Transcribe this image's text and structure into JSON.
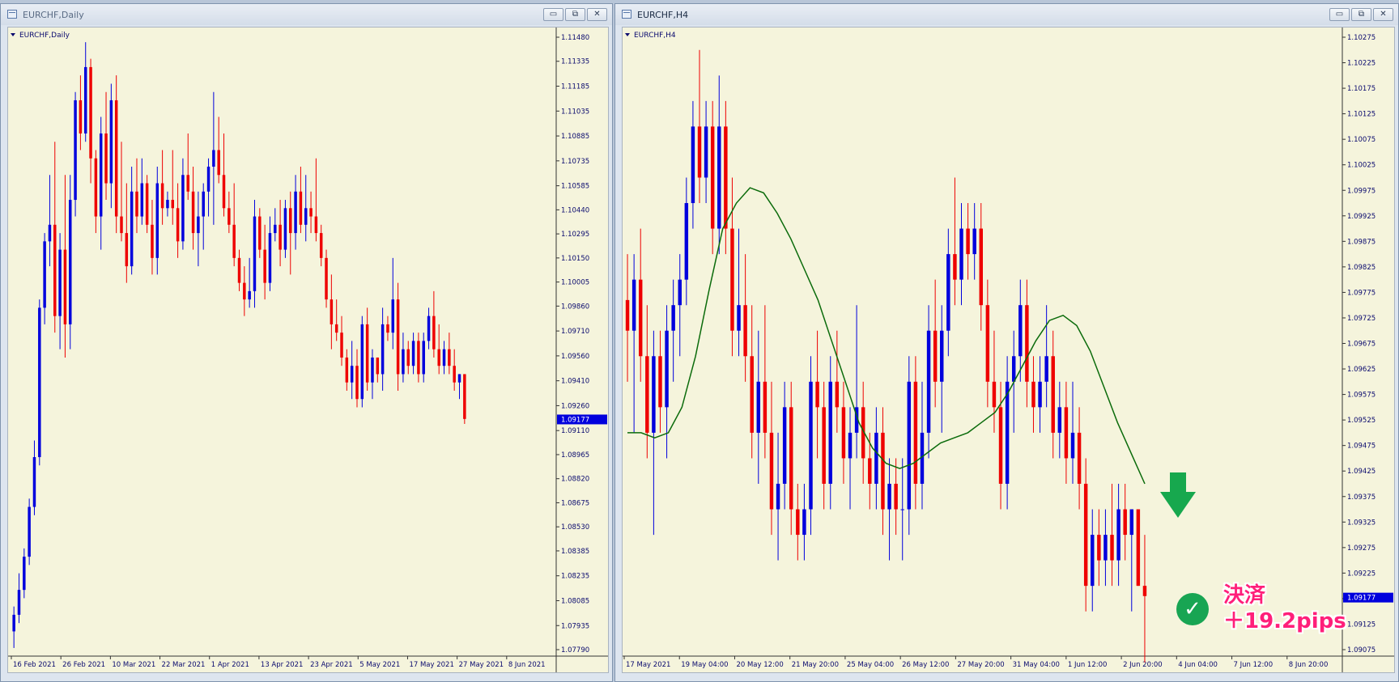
{
  "windows": [
    {
      "title": "EURCHF,Daily",
      "symbol_label": "EURCHF,Daily"
    },
    {
      "title": "EURCHF,H4",
      "symbol_label": "EURCHF,H4"
    }
  ],
  "buttons": {
    "minimize": "▭",
    "restore": "⧉",
    "close": "✕"
  },
  "colors": {
    "bull": "#0000dd",
    "bear": "#ee0000",
    "ma": "#0b6b0b",
    "background": "#f5f4dc",
    "axis_text": "#0a0a6e",
    "price_tag": "#0000dd",
    "callout": "#ff1f7a",
    "check": "#18a553",
    "arrow": "#17a84e"
  },
  "annotation": {
    "line1": "決済",
    "line2": "＋19.2pips",
    "check_icon": "check-circle-icon",
    "arrow_icon": "down-arrow-icon"
  },
  "chart_data": [
    {
      "type": "candlestick",
      "title": "EURCHF,Daily",
      "price_ticks": [
        "1.11480",
        "1.11335",
        "1.11185",
        "1.11035",
        "1.10885",
        "1.10735",
        "1.10585",
        "1.10440",
        "1.10295",
        "1.10150",
        "1.10005",
        "1.09860",
        "1.09710",
        "1.09560",
        "1.09410",
        "1.09260",
        "1.09110",
        "1.08965",
        "1.08820",
        "1.08675",
        "1.08530",
        "1.08385",
        "1.08235",
        "1.08085",
        "1.07935",
        "1.07790"
      ],
      "ylim": [
        1.0779,
        1.1148
      ],
      "current_price": "1.09177",
      "date_ticks": [
        "16 Feb 2021",
        "26 Feb 2021",
        "10 Mar 2021",
        "22 Mar 2021",
        "1 Apr 2021",
        "13 Apr 2021",
        "23 Apr 2021",
        "5 May 2021",
        "17 May 2021",
        "27 May 2021",
        "8 Jun 2021"
      ],
      "ohlc": [
        [
          1.079,
          1.0805,
          1.078,
          1.08
        ],
        [
          1.08,
          1.0825,
          1.0795,
          1.0815
        ],
        [
          1.0815,
          1.084,
          1.081,
          1.0835
        ],
        [
          1.0835,
          1.087,
          1.083,
          1.0865
        ],
        [
          1.0865,
          1.0905,
          1.086,
          1.0895
        ],
        [
          1.0895,
          1.099,
          1.089,
          1.0985
        ],
        [
          1.0985,
          1.103,
          1.0975,
          1.1025
        ],
        [
          1.1025,
          1.1065,
          1.101,
          1.1035
        ],
        [
          1.1035,
          1.1085,
          1.097,
          1.098
        ],
        [
          1.098,
          1.103,
          1.096,
          1.102
        ],
        [
          1.102,
          1.1065,
          1.0955,
          1.0975
        ],
        [
          1.0975,
          1.1065,
          1.096,
          1.105
        ],
        [
          1.105,
          1.1115,
          1.104,
          1.111
        ],
        [
          1.111,
          1.1125,
          1.108,
          1.109
        ],
        [
          1.109,
          1.1145,
          1.1085,
          1.113
        ],
        [
          1.113,
          1.1135,
          1.106,
          1.1075
        ],
        [
          1.1075,
          1.108,
          1.103,
          1.104
        ],
        [
          1.104,
          1.11,
          1.102,
          1.109
        ],
        [
          1.109,
          1.1115,
          1.105,
          1.106
        ],
        [
          1.106,
          1.112,
          1.1045,
          1.111
        ],
        [
          1.111,
          1.1125,
          1.103,
          1.104
        ],
        [
          1.104,
          1.1085,
          1.1025,
          1.103
        ],
        [
          1.103,
          1.106,
          1.1,
          1.101
        ],
        [
          1.101,
          1.107,
          1.1005,
          1.1055
        ],
        [
          1.1055,
          1.1075,
          1.103,
          1.104
        ],
        [
          1.104,
          1.1075,
          1.1035,
          1.106
        ],
        [
          1.106,
          1.1065,
          1.103,
          1.1035
        ],
        [
          1.1035,
          1.105,
          1.1005,
          1.1015
        ],
        [
          1.1015,
          1.107,
          1.1005,
          1.106
        ],
        [
          1.106,
          1.108,
          1.1035,
          1.1045
        ],
        [
          1.1045,
          1.1055,
          1.104,
          1.105
        ],
        [
          1.105,
          1.108,
          1.1035,
          1.1045
        ],
        [
          1.1045,
          1.106,
          1.1015,
          1.1025
        ],
        [
          1.1025,
          1.1075,
          1.102,
          1.1065
        ],
        [
          1.1065,
          1.109,
          1.105,
          1.1055
        ],
        [
          1.1055,
          1.107,
          1.102,
          1.103
        ],
        [
          1.103,
          1.1055,
          1.101,
          1.104
        ],
        [
          1.104,
          1.106,
          1.102,
          1.1055
        ],
        [
          1.1055,
          1.1075,
          1.104,
          1.107
        ],
        [
          1.107,
          1.1115,
          1.1035,
          1.108
        ],
        [
          1.108,
          1.11,
          1.106,
          1.1065
        ],
        [
          1.1065,
          1.109,
          1.104,
          1.1045
        ],
        [
          1.1045,
          1.1055,
          1.103,
          1.1035
        ],
        [
          1.1035,
          1.106,
          1.101,
          1.1015
        ],
        [
          1.1015,
          1.102,
          1.0995,
          1.1
        ],
        [
          1.1,
          1.101,
          1.098,
          1.099
        ],
        [
          1.099,
          1.1015,
          1.0985,
          1.0995
        ],
        [
          1.0995,
          1.105,
          1.0985,
          1.104
        ],
        [
          1.104,
          1.1045,
          1.1015,
          1.102
        ],
        [
          1.102,
          1.1035,
          1.099,
          1.1
        ],
        [
          1.1,
          1.104,
          1.0995,
          1.103
        ],
        [
          1.103,
          1.1045,
          1.1025,
          1.1035
        ],
        [
          1.1035,
          1.105,
          1.101,
          1.102
        ],
        [
          1.102,
          1.105,
          1.1015,
          1.1045
        ],
        [
          1.1045,
          1.1055,
          1.1005,
          1.103
        ],
        [
          1.103,
          1.1065,
          1.102,
          1.1055
        ],
        [
          1.1055,
          1.107,
          1.103,
          1.1035
        ],
        [
          1.1035,
          1.1065,
          1.1025,
          1.1045
        ],
        [
          1.1045,
          1.1055,
          1.103,
          1.104
        ],
        [
          1.104,
          1.1075,
          1.1025,
          1.103
        ],
        [
          1.103,
          1.1035,
          1.101,
          1.1015
        ],
        [
          1.1015,
          1.102,
          1.0985,
          1.099
        ],
        [
          1.099,
          1.1005,
          1.096,
          1.0975
        ],
        [
          1.0975,
          1.099,
          1.0965,
          1.097
        ],
        [
          1.097,
          1.098,
          1.095,
          1.0955
        ],
        [
          1.0955,
          1.096,
          1.0935,
          1.094
        ],
        [
          1.094,
          1.0965,
          1.093,
          1.095
        ],
        [
          1.095,
          1.096,
          1.0925,
          1.093
        ],
        [
          1.093,
          1.098,
          1.0925,
          1.0975
        ],
        [
          1.0975,
          1.0985,
          1.0935,
          1.094
        ],
        [
          1.094,
          1.096,
          1.093,
          1.0955
        ],
        [
          1.0955,
          1.0955,
          1.094,
          1.0945
        ],
        [
          1.0945,
          1.0985,
          1.0935,
          1.0975
        ],
        [
          1.0975,
          1.098,
          1.0965,
          1.097
        ],
        [
          1.097,
          1.1015,
          1.096,
          1.099
        ],
        [
          1.099,
          1.1,
          1.0935,
          1.0945
        ],
        [
          1.0945,
          1.097,
          1.094,
          1.096
        ],
        [
          1.096,
          1.0965,
          1.0945,
          1.095
        ],
        [
          1.095,
          1.097,
          1.0945,
          1.0965
        ],
        [
          1.0965,
          1.097,
          1.094,
          1.0945
        ],
        [
          1.0945,
          1.097,
          1.094,
          1.0965
        ],
        [
          1.0965,
          1.0985,
          1.096,
          1.098
        ],
        [
          1.098,
          1.0995,
          1.0955,
          1.096
        ],
        [
          1.096,
          1.0975,
          1.0945,
          1.095
        ],
        [
          1.095,
          1.0965,
          1.0945,
          1.096
        ],
        [
          1.096,
          1.097,
          1.0945,
          1.095
        ],
        [
          1.095,
          1.096,
          1.0935,
          1.094
        ],
        [
          1.094,
          1.0945,
          1.093,
          1.0945
        ],
        [
          1.0945,
          1.0945,
          1.0915,
          1.0918
        ]
      ]
    },
    {
      "type": "candlestick",
      "title": "EURCHF,H4",
      "price_ticks": [
        "1.10275",
        "1.10225",
        "1.10175",
        "1.10125",
        "1.10075",
        "1.10025",
        "1.09975",
        "1.09925",
        "1.09875",
        "1.09825",
        "1.09775",
        "1.09725",
        "1.09675",
        "1.09625",
        "1.09575",
        "1.09525",
        "1.09475",
        "1.09425",
        "1.09375",
        "1.09325",
        "1.09275",
        "1.09225",
        "1.09175",
        "1.09125",
        "1.09075"
      ],
      "ylim": [
        1.09075,
        1.10275
      ],
      "current_price": "1.09177",
      "date_ticks": [
        "17 May 2021",
        "19 May 04:00",
        "20 May 12:00",
        "21 May 20:00",
        "25 May 04:00",
        "26 May 12:00",
        "27 May 20:00",
        "31 May 04:00",
        "1 Jun 12:00",
        "2 Jun 20:00",
        "4 Jun 04:00",
        "7 Jun 12:00",
        "8 Jun 20:00"
      ],
      "ohlc": [
        [
          1.0976,
          1.0985,
          1.096,
          1.097
        ],
        [
          1.097,
          1.0985,
          1.095,
          1.098
        ],
        [
          1.098,
          1.099,
          1.096,
          1.0965
        ],
        [
          1.0965,
          1.0975,
          1.0945,
          1.095
        ],
        [
          1.095,
          1.097,
          1.093,
          1.0965
        ],
        [
          1.0965,
          1.097,
          1.095,
          1.0955
        ],
        [
          1.0955,
          1.0975,
          1.0945,
          1.097
        ],
        [
          1.097,
          1.098,
          1.096,
          1.0975
        ],
        [
          1.0975,
          1.0985,
          1.0965,
          1.098
        ],
        [
          1.098,
          1.1,
          1.0975,
          1.0995
        ],
        [
          1.0995,
          1.1015,
          1.099,
          1.101
        ],
        [
          1.101,
          1.1025,
          1.0995,
          1.1
        ],
        [
          1.1,
          1.1015,
          1.0995,
          1.101
        ],
        [
          1.101,
          1.1015,
          1.0985,
          1.099
        ],
        [
          1.099,
          1.102,
          1.0985,
          1.101
        ],
        [
          1.101,
          1.1015,
          1.0985,
          1.099
        ],
        [
          1.099,
          1.1,
          1.0965,
          1.097
        ],
        [
          1.097,
          1.099,
          1.0965,
          1.0975
        ],
        [
          1.0975,
          1.0985,
          1.096,
          1.0965
        ],
        [
          1.0965,
          1.0975,
          1.0945,
          1.095
        ],
        [
          1.095,
          1.097,
          1.094,
          1.096
        ],
        [
          1.096,
          1.0975,
          1.0945,
          1.095
        ],
        [
          1.095,
          1.096,
          1.093,
          1.0935
        ],
        [
          1.0935,
          1.095,
          1.0925,
          1.094
        ],
        [
          1.094,
          1.096,
          1.0935,
          1.0955
        ],
        [
          1.0955,
          1.096,
          1.093,
          1.0935
        ],
        [
          1.0935,
          1.094,
          1.0925,
          1.093
        ],
        [
          1.093,
          1.094,
          1.0925,
          1.0935
        ],
        [
          1.0935,
          1.0965,
          1.093,
          1.096
        ],
        [
          1.096,
          1.097,
          1.0945,
          1.0955
        ],
        [
          1.0955,
          1.096,
          1.0935,
          1.094
        ],
        [
          1.094,
          1.0965,
          1.0935,
          1.096
        ],
        [
          1.096,
          1.097,
          1.095,
          1.0955
        ],
        [
          1.0955,
          1.096,
          1.094,
          1.0945
        ],
        [
          1.0945,
          1.0955,
          1.0935,
          1.095
        ],
        [
          1.095,
          1.0975,
          1.0945,
          1.0955
        ],
        [
          1.0955,
          1.096,
          1.094,
          1.0945
        ],
        [
          1.0945,
          1.095,
          1.0935,
          1.094
        ],
        [
          1.094,
          1.0955,
          1.0935,
          1.095
        ],
        [
          1.095,
          1.0955,
          1.093,
          1.0935
        ],
        [
          1.0935,
          1.0945,
          1.0925,
          1.094
        ],
        [
          1.094,
          1.0945,
          1.093,
          1.0935
        ],
        [
          1.0935,
          1.0945,
          1.0925,
          1.0935
        ],
        [
          1.0935,
          1.0965,
          1.093,
          1.096
        ],
        [
          1.096,
          1.0965,
          1.0935,
          1.094
        ],
        [
          1.094,
          1.096,
          1.0935,
          1.095
        ],
        [
          1.095,
          1.0975,
          1.0945,
          1.097
        ],
        [
          1.097,
          1.098,
          1.0955,
          1.096
        ],
        [
          1.096,
          1.0975,
          1.095,
          1.097
        ],
        [
          1.097,
          1.099,
          1.0965,
          1.0985
        ],
        [
          1.0985,
          1.1,
          1.0975,
          1.098
        ],
        [
          1.098,
          1.0995,
          1.0975,
          1.099
        ],
        [
          1.099,
          1.0995,
          1.098,
          1.0985
        ],
        [
          1.0985,
          1.0995,
          1.098,
          1.099
        ],
        [
          1.099,
          1.0995,
          1.097,
          1.0975
        ],
        [
          1.0975,
          1.098,
          1.0955,
          1.096
        ],
        [
          1.096,
          1.097,
          1.095,
          1.0955
        ],
        [
          1.0955,
          1.096,
          1.0935,
          1.094
        ],
        [
          1.094,
          1.0965,
          1.0935,
          1.096
        ],
        [
          1.096,
          1.097,
          1.095,
          1.0965
        ],
        [
          1.0965,
          1.098,
          1.096,
          1.0975
        ],
        [
          1.0975,
          1.098,
          1.0955,
          1.096
        ],
        [
          1.096,
          1.0965,
          1.095,
          1.0955
        ],
        [
          1.0955,
          1.0965,
          1.095,
          1.096
        ],
        [
          1.096,
          1.0975,
          1.0955,
          1.0965
        ],
        [
          1.0965,
          1.097,
          1.0945,
          1.095
        ],
        [
          1.095,
          1.096,
          1.0945,
          1.0955
        ],
        [
          1.0955,
          1.096,
          1.094,
          1.0945
        ],
        [
          1.0945,
          1.096,
          1.094,
          1.095
        ],
        [
          1.095,
          1.0955,
          1.0935,
          1.094
        ],
        [
          1.094,
          1.0945,
          1.0915,
          1.092
        ],
        [
          1.092,
          1.0935,
          1.0915,
          1.093
        ],
        [
          1.093,
          1.0935,
          1.092,
          1.0925
        ],
        [
          1.0925,
          1.0935,
          1.092,
          1.093
        ],
        [
          1.093,
          1.094,
          1.092,
          1.0925
        ],
        [
          1.0925,
          1.094,
          1.092,
          1.0935
        ],
        [
          1.0935,
          1.094,
          1.0925,
          1.093
        ],
        [
          1.093,
          1.0935,
          1.0915,
          1.0935
        ],
        [
          1.0935,
          1.0935,
          1.092,
          1.092
        ],
        [
          1.092,
          1.093,
          1.0905,
          1.0918
        ]
      ],
      "moving_average": {
        "values": [
          1.095,
          1.095,
          1.0949,
          1.095,
          1.0955,
          1.0965,
          1.0978,
          1.099,
          1.0995,
          1.0998,
          1.0997,
          1.0993,
          1.0988,
          1.0982,
          1.0976,
          1.0968,
          1.096,
          1.0952,
          1.0947,
          1.0944,
          1.0943,
          1.0944,
          1.0946,
          1.0948,
          1.0949,
          1.095,
          1.0952,
          1.0954,
          1.0958,
          1.0963,
          1.0968,
          1.0972,
          1.0973,
          1.0971,
          1.0966,
          1.0959,
          1.0952,
          1.0946,
          1.094
        ]
      }
    }
  ]
}
